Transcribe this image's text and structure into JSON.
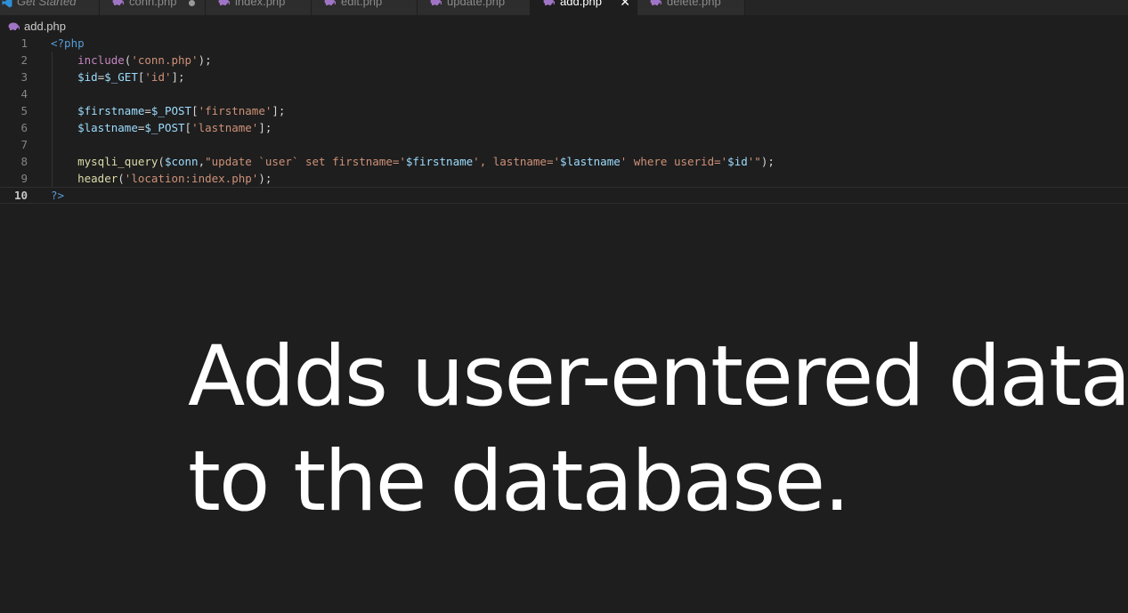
{
  "tabs": [
    {
      "label": "Get Started",
      "icon": "vscode-icon",
      "italic": true
    },
    {
      "label": "conn.php",
      "icon": "php-icon",
      "dirty": true
    },
    {
      "label": "index.php",
      "icon": "php-icon"
    },
    {
      "label": "edit.php",
      "icon": "php-icon"
    },
    {
      "label": "update.php",
      "icon": "php-icon"
    },
    {
      "label": "add.php",
      "icon": "php-icon",
      "active": true,
      "close": "✕"
    },
    {
      "label": "delete.php",
      "icon": "php-icon"
    }
  ],
  "breadcrumb": {
    "file": "add.php"
  },
  "editor": {
    "current_line": 10,
    "lines": [
      {
        "num": "1",
        "tokens": [
          {
            "t": "<?php",
            "c": "tag"
          }
        ]
      },
      {
        "num": "2",
        "tokens": [
          {
            "t": "    "
          },
          {
            "t": "include",
            "c": "kw"
          },
          {
            "t": "("
          },
          {
            "t": "'conn.php'",
            "c": "str"
          },
          {
            "t": ");"
          }
        ]
      },
      {
        "num": "3",
        "tokens": [
          {
            "t": "    "
          },
          {
            "t": "$id",
            "c": "var"
          },
          {
            "t": "="
          },
          {
            "t": "$_GET",
            "c": "var"
          },
          {
            "t": "["
          },
          {
            "t": "'id'",
            "c": "str"
          },
          {
            "t": "];"
          }
        ]
      },
      {
        "num": "4",
        "tokens": []
      },
      {
        "num": "5",
        "tokens": [
          {
            "t": "    "
          },
          {
            "t": "$firstname",
            "c": "var"
          },
          {
            "t": "="
          },
          {
            "t": "$_POST",
            "c": "var"
          },
          {
            "t": "["
          },
          {
            "t": "'firstname'",
            "c": "str"
          },
          {
            "t": "];"
          }
        ]
      },
      {
        "num": "6",
        "tokens": [
          {
            "t": "    "
          },
          {
            "t": "$lastname",
            "c": "var"
          },
          {
            "t": "="
          },
          {
            "t": "$_POST",
            "c": "var"
          },
          {
            "t": "["
          },
          {
            "t": "'lastname'",
            "c": "str"
          },
          {
            "t": "];"
          }
        ]
      },
      {
        "num": "7",
        "tokens": []
      },
      {
        "num": "8",
        "tokens": [
          {
            "t": "    "
          },
          {
            "t": "mysqli_query",
            "c": "fn"
          },
          {
            "t": "("
          },
          {
            "t": "$conn",
            "c": "var"
          },
          {
            "t": ","
          },
          {
            "t": "\"update `user` set firstname='",
            "c": "str"
          },
          {
            "t": "$firstname",
            "c": "var"
          },
          {
            "t": "', lastname='",
            "c": "str"
          },
          {
            "t": "$lastname",
            "c": "var"
          },
          {
            "t": "' where userid='",
            "c": "str"
          },
          {
            "t": "$id",
            "c": "var"
          },
          {
            "t": "'\"",
            "c": "str"
          },
          {
            "t": ");"
          }
        ]
      },
      {
        "num": "9",
        "tokens": [
          {
            "t": "    "
          },
          {
            "t": "header",
            "c": "fn"
          },
          {
            "t": "("
          },
          {
            "t": "'location:index.php'",
            "c": "str"
          },
          {
            "t": ");"
          }
        ]
      },
      {
        "num": "10",
        "tokens": [
          {
            "t": "?>",
            "c": "tag"
          }
        ]
      }
    ]
  },
  "caption": {
    "line1": "Adds user-entered data",
    "line2": "to the database."
  },
  "colors": {
    "background": "#1e1e1e",
    "tag": "#569cd6",
    "keyword": "#c586c0",
    "function": "#dcdcaa",
    "string": "#ce9178",
    "variable": "#9cdcfe",
    "php_icon": "#a074c4"
  }
}
